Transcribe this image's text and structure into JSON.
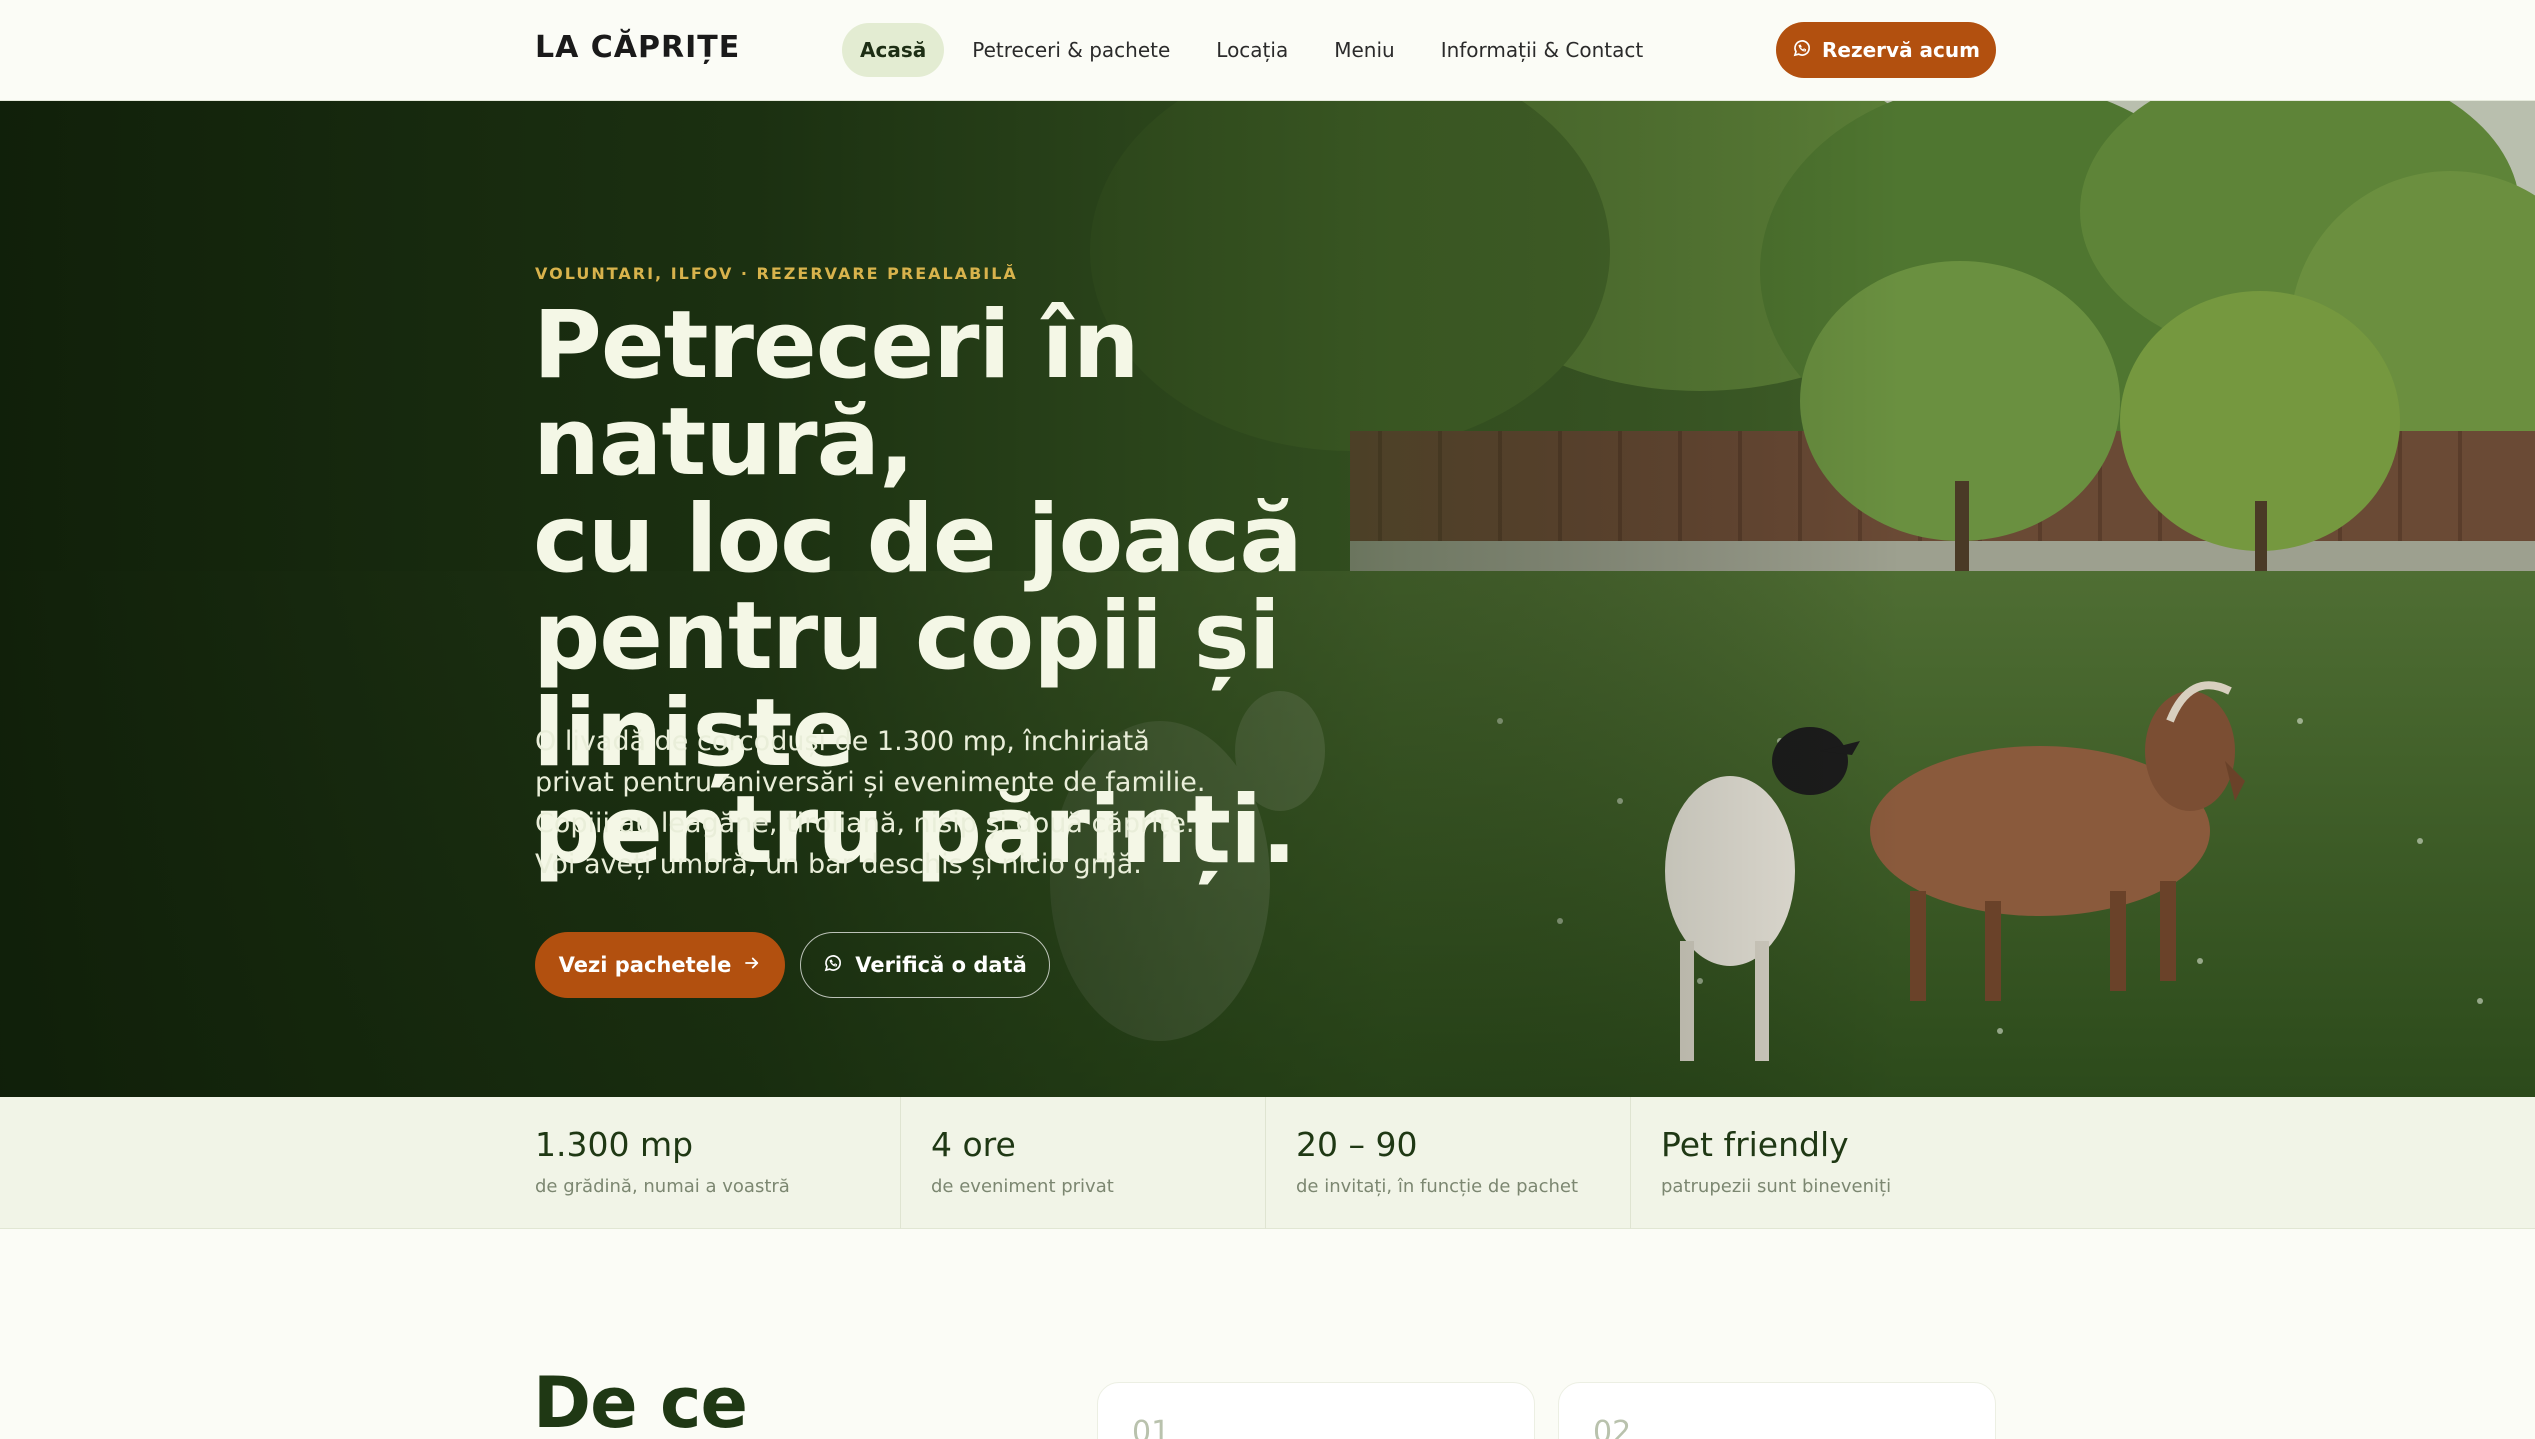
{
  "header": {
    "logo": "LA CĂPRIȚE",
    "nav": [
      {
        "label": "Acasă",
        "active": true
      },
      {
        "label": "Petreceri & pachete",
        "active": false
      },
      {
        "label": "Locația",
        "active": false
      },
      {
        "label": "Meniu",
        "active": false
      },
      {
        "label": "Informații & Contact",
        "active": false
      }
    ],
    "cta": {
      "label": "Rezervă acum",
      "icon": "whatsapp-icon"
    }
  },
  "hero": {
    "eyebrow": "VOLUNTARI, ILFOV · REZERVARE PREALABILĂ",
    "title_lines": [
      "Petreceri în natură,",
      "cu loc de joacă",
      "pentru copii și liniște",
      "pentru părinți."
    ],
    "description": "O livadă de corcoduși de 1.300 mp, închiriată privat pentru aniversări și evenimente de familie. Copiii au leagăne, tiroliană, nisip și două căprițe. Voi aveți umbră, un bar deschis și nicio grijă.",
    "primary_button": {
      "label": "Vezi pachetele",
      "icon": "arrow-right-icon"
    },
    "secondary_button": {
      "label": "Verifică o dată",
      "icon": "whatsapp-icon"
    }
  },
  "stats": [
    {
      "value": "1.300 mp",
      "label": "de grădină, numai a voastră"
    },
    {
      "value": "4 ore",
      "label": "de eveniment privat"
    },
    {
      "value": "20 – 90",
      "label": "de invitați, în funcție de pachet"
    },
    {
      "value": "Pet friendly",
      "label": "patrupezii sunt bineveniți"
    }
  ],
  "section": {
    "title": "De ce",
    "cards": [
      {
        "number": "01"
      },
      {
        "number": "02"
      }
    ]
  },
  "colors": {
    "accent": "#b2500f",
    "eyebrow": "#d8b34c",
    "dark_green": "#1f3814",
    "nav_active_bg": "#e3ecd2",
    "stats_bg": "#f1f4e7"
  }
}
